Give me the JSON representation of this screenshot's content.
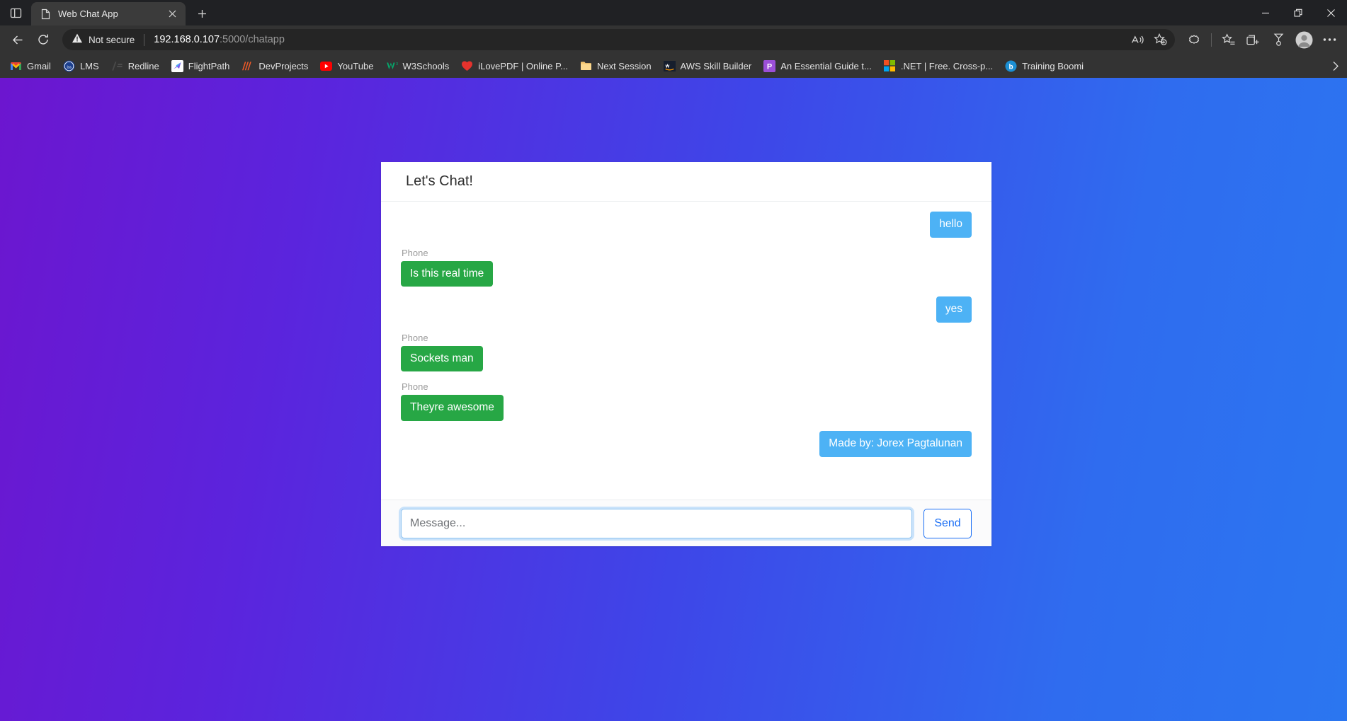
{
  "window": {
    "controls": [
      {
        "name": "minimize",
        "glyph": "—"
      },
      {
        "name": "restore",
        "glyph": "❐"
      },
      {
        "name": "close",
        "glyph": "✕"
      }
    ]
  },
  "tabstrip": {
    "split_view_label": "split-view",
    "tab": {
      "title": "Web Chat App",
      "favicon": "document-icon",
      "close_label": "✕"
    },
    "new_tab_label": "+"
  },
  "navbar": {
    "back_label": "←",
    "refresh_label": "↻",
    "security": {
      "icon": "warning-triangle-icon",
      "text": "Not secure"
    },
    "url": {
      "host": "192.168.0.107",
      "path": ":5000/chatapp"
    },
    "omni_actions": [
      {
        "name": "read-aloud-icon",
        "label": "A"
      },
      {
        "name": "add-favorite-icon",
        "label": "☆"
      }
    ],
    "toolbar_buttons": [
      {
        "name": "extensions-icon",
        "label": "extensions"
      },
      {
        "name": "favorites-icon",
        "label": "favorites"
      },
      {
        "name": "collections-icon",
        "label": "collections"
      },
      {
        "name": "rewards-icon",
        "label": "rewards"
      }
    ],
    "profile_label": "profile",
    "settings_label": "···"
  },
  "bookmarks": {
    "items": [
      {
        "label": "Gmail",
        "icon": "gmail-icon"
      },
      {
        "label": "LMS",
        "icon": "lms-icon"
      },
      {
        "label": "Redline",
        "icon": "redline-icon"
      },
      {
        "label": "FlightPath",
        "icon": "flightpath-icon"
      },
      {
        "label": "DevProjects",
        "icon": "devprojects-icon"
      },
      {
        "label": "YouTube",
        "icon": "youtube-icon"
      },
      {
        "label": "W3Schools",
        "icon": "w3schools-icon"
      },
      {
        "label": "iLovePDF | Online P...",
        "icon": "ilovepdf-icon"
      },
      {
        "label": "Next Session",
        "icon": "folder-icon"
      },
      {
        "label": "AWS Skill Builder",
        "icon": "aws-icon"
      },
      {
        "label": "An Essential Guide t...",
        "icon": "powerpoint-icon"
      },
      {
        "label": ".NET | Free. Cross-p...",
        "icon": "microsoft-icon"
      },
      {
        "label": "Training Boomi",
        "icon": "boomi-icon"
      }
    ],
    "overflow_label": "›"
  },
  "app": {
    "title": "Let's Chat!",
    "messages": [
      {
        "direction": "out",
        "sender": null,
        "text": "hello"
      },
      {
        "direction": "in",
        "sender": "Phone",
        "text": "Is this real time"
      },
      {
        "direction": "out",
        "sender": null,
        "text": "yes"
      },
      {
        "direction": "in",
        "sender": "Phone",
        "text": "Sockets man"
      },
      {
        "direction": "in",
        "sender": "Phone",
        "text": "Theyre awesome"
      },
      {
        "direction": "out",
        "sender": null,
        "text": "Made by: Jorex Pagtalunan"
      }
    ],
    "composer": {
      "placeholder": "Message...",
      "value": "",
      "send_label": "Send"
    }
  },
  "colors": {
    "bg_gradient_start": "#6c16cf",
    "bg_gradient_end": "#2b76f0",
    "bubble_out": "#4db2f5",
    "bubble_in": "#27a745",
    "send_accent": "#1a6ef5"
  }
}
